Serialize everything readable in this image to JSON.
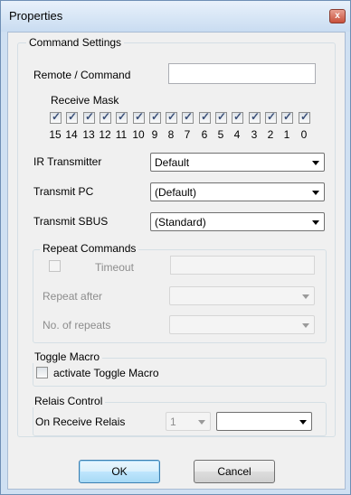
{
  "window": {
    "title": "Properties",
    "close_glyph": "x"
  },
  "command_settings": {
    "legend": "Command Settings",
    "remote_label": "Remote / Command",
    "remote_value": "",
    "receive_mask_label": "Receive Mask",
    "bits": [
      {
        "label": "15",
        "checked": true
      },
      {
        "label": "14",
        "checked": true
      },
      {
        "label": "13",
        "checked": true
      },
      {
        "label": "12",
        "checked": true
      },
      {
        "label": "11",
        "checked": true
      },
      {
        "label": "10",
        "checked": true
      },
      {
        "label": "9",
        "checked": true
      },
      {
        "label": "8",
        "checked": true
      },
      {
        "label": "7",
        "checked": true
      },
      {
        "label": "6",
        "checked": true
      },
      {
        "label": "5",
        "checked": true
      },
      {
        "label": "4",
        "checked": true
      },
      {
        "label": "3",
        "checked": true
      },
      {
        "label": "2",
        "checked": true
      },
      {
        "label": "1",
        "checked": true
      },
      {
        "label": "0",
        "checked": true
      }
    ],
    "ir_label": "IR Transmitter",
    "ir_value": "Default",
    "pc_label": "Transmit PC",
    "pc_value": "(Default)",
    "sbus_label": "Transmit SBUS",
    "sbus_value": "(Standard)"
  },
  "repeat": {
    "legend": "Repeat Commands",
    "timeout_label": "Timeout",
    "timeout_value": "",
    "after_label": "Repeat after",
    "after_value": "",
    "count_label": "No. of repeats",
    "count_value": ""
  },
  "toggle": {
    "legend": "Toggle Macro",
    "checkbox_label": "activate Toggle Macro"
  },
  "relais": {
    "legend": "Relais Control",
    "label": "On Receive Relais",
    "num_value": "1",
    "action_value": ""
  },
  "buttons": {
    "ok": "OK",
    "cancel": "Cancel"
  }
}
